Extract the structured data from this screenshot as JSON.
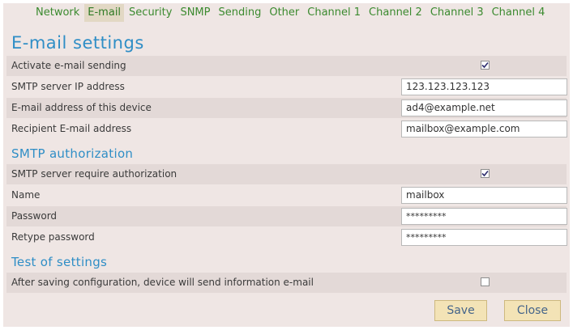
{
  "tabs": [
    "Network",
    "E-mail",
    "Security",
    "SNMP",
    "Sending",
    "Other",
    "Channel 1",
    "Channel 2",
    "Channel 3",
    "Channel 4"
  ],
  "active_tab": "E-mail",
  "page_title": "E-mail settings",
  "email": {
    "activate_label": "Activate e-mail sending",
    "activate_checked": true,
    "smtp_ip_label": "SMTP server IP address",
    "smtp_ip_value": "123.123.123.123",
    "device_email_label": "E-mail address of this device",
    "device_email_value": "ad4@example.net",
    "recipient_label": "Recipient E-mail address",
    "recipient_value": "mailbox@example.com"
  },
  "auth": {
    "section_title": "SMTP authorization",
    "require_label": "SMTP server require authorization",
    "require_checked": true,
    "name_label": "Name",
    "name_value": "mailbox",
    "password_label": "Password",
    "password_value": "*********",
    "retype_label": "Retype password",
    "retype_value": "*********"
  },
  "test": {
    "section_title": "Test of settings",
    "send_label": "After saving configuration, device will send information e-mail",
    "send_checked": false
  },
  "buttons": {
    "save": "Save",
    "close": "Close"
  },
  "colors": {
    "tab_text": "#3b8a2f",
    "heading": "#2f8ec6",
    "panel_bg": "#efe6e4",
    "row_shade": "#e3d9d7",
    "button_bg": "#f3e3b6"
  }
}
